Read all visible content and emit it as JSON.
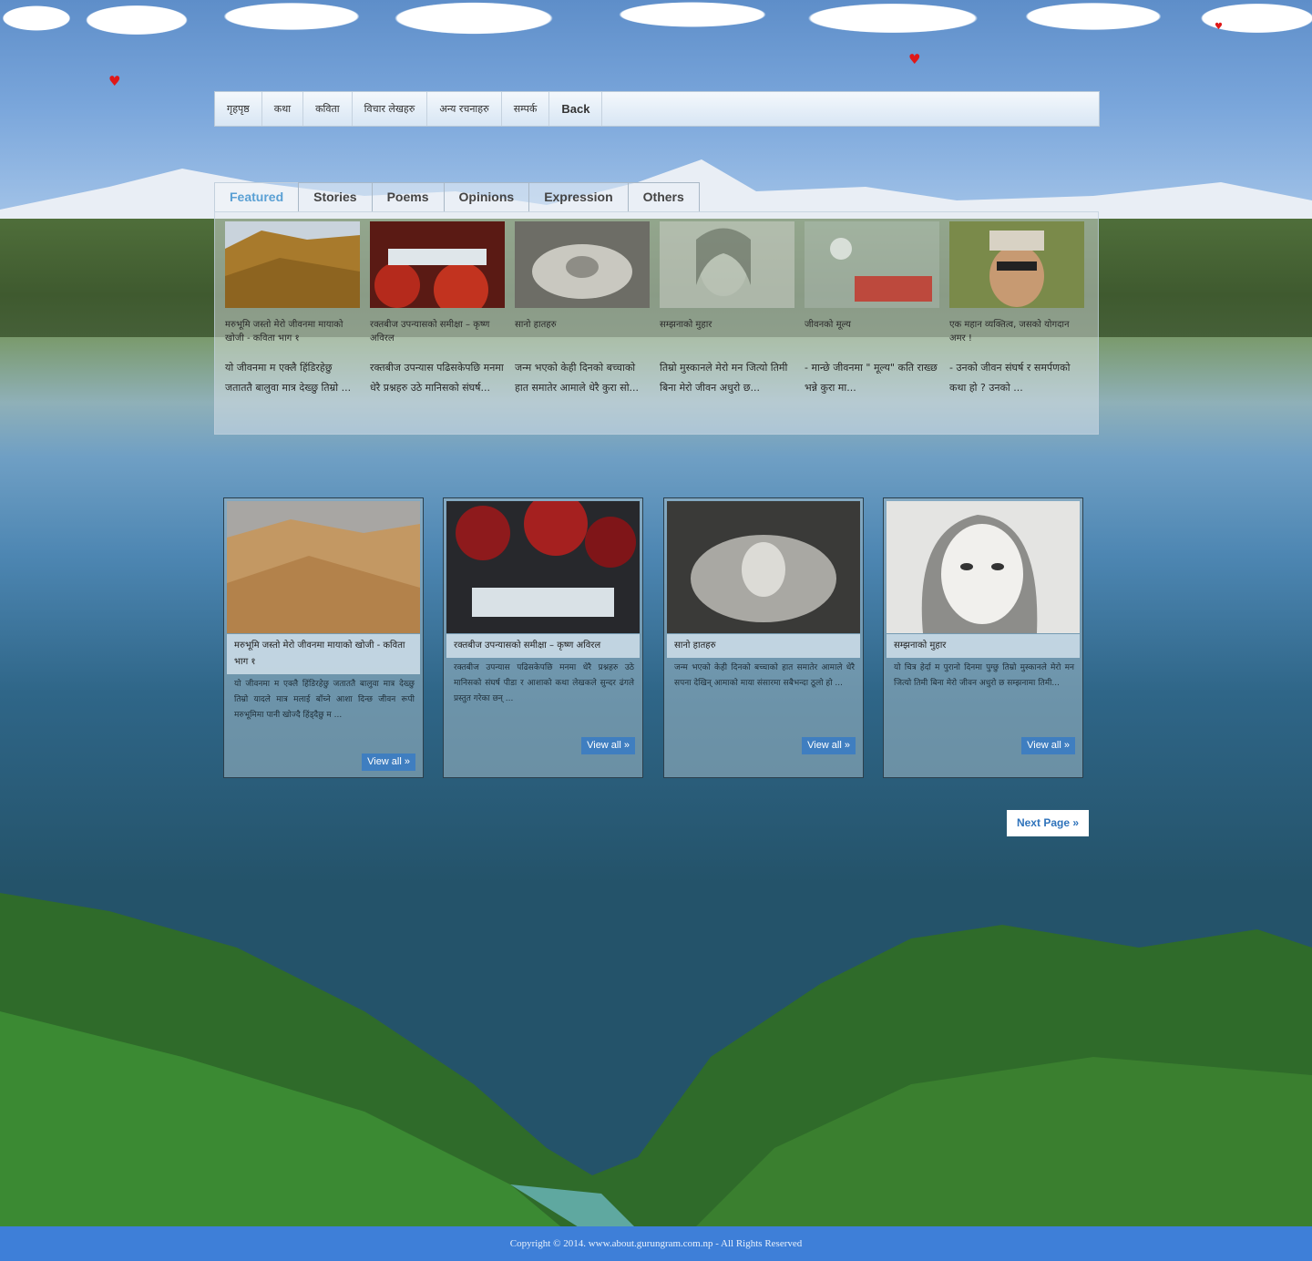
{
  "nav": {
    "items": [
      "गृहपृष्ठ",
      "कथा",
      "कविता",
      "विचार लेखहरु",
      "अन्य रचनाहरु",
      "सम्पर्क"
    ],
    "back_label": "Back"
  },
  "tabs": [
    "Featured",
    "Stories",
    "Poems",
    "Opinions",
    "Expression",
    "Others"
  ],
  "featured": [
    {
      "title": "मरुभूमि जस्तो मेरो जीवनमा मायाको खोजी - कविता भाग १",
      "excerpt": "यो जीवनमा म एक्लै हिंडिरहेछु जताततै बालुवा मात्र देख्छु तिम्रो ..."
    },
    {
      "title": "रक्तबीज उपन्यासको समीक्षा – कृष्ण अविरल",
      "excerpt": "रक्तबीज उपन्यास पढिसकेपछि मनमा धेरै प्रश्नहरु उठे मानिसको संघर्ष..."
    },
    {
      "title": "सानो हातहरु",
      "excerpt": "जन्म भएको केही दिनको बच्चाको हात समातेर आमाले धेरै कुरा सो..."
    },
    {
      "title": "सम्झनाको मुहार",
      "excerpt": "तिम्रो मुस्कानले मेरो मन जित्यो तिमी बिना मेरो जीवन अधुरो छ..."
    },
    {
      "title": "जीवनको मूल्य",
      "excerpt": "- मान्छे जीवनमा \" मूल्य\" कति राख्छ भन्ने कुरा मा..."
    },
    {
      "title": "एक महान व्यक्तित्व, जसको योगदान अमर !",
      "excerpt": "- उनको जीवन संघर्ष र समर्पणको कथा हो ? उनको ..."
    }
  ],
  "cards": [
    {
      "title": "मरुभूमि जस्तो मेरो जीवनमा मायाको खोजी - कविता भाग १",
      "excerpt": "यो जीवनमा म एक्लै हिंडिरहेछु जताततै बालुवा मात्र देख्छु तिम्रो यादले मात्र मलाई बाँच्ने आशा दिन्छ जीवन रूपी मरुभूमिमा पानी खोज्दै हिंड्दैछु म ...",
      "view_all": "View all »"
    },
    {
      "title": "रक्तबीज उपन्यासको समीक्षा – कृष्ण अविरल",
      "excerpt": "रक्तबीज उपन्यास पढिसकेपछि मनमा धेरै प्रश्नहरु उठे मानिसको संघर्ष पीडा र आशाको कथा लेखकले सुन्दर ढंगले प्रस्तुत गरेका छन् ...",
      "view_all": "View all »"
    },
    {
      "title": "सानो हातहरु",
      "excerpt": "जन्म भएको केही दिनको बच्चाको हात समातेर आमाले धेरै सपना देखिन् आमाको माया संसारमा सबैभन्दा ठूलो हो ...",
      "view_all": "View all »"
    },
    {
      "title": "सम्झनाको मुहार",
      "excerpt": "यो चित्र हेर्दा म पुरानो दिनमा पुग्छु तिम्रो मुस्कानले मेरो मन जित्यो तिमी बिना मेरो जीवन अधुरो छ सम्झनामा तिमी...",
      "view_all": "View all »"
    }
  ],
  "next_page": "Next Page »",
  "footer": "Copyright © 2014. www.about.gurungram.com.np - All Rights Reserved",
  "colors": {
    "accent": "#3e7fd8",
    "active_tab": "#5aa0d4",
    "heart": "#e01818"
  }
}
